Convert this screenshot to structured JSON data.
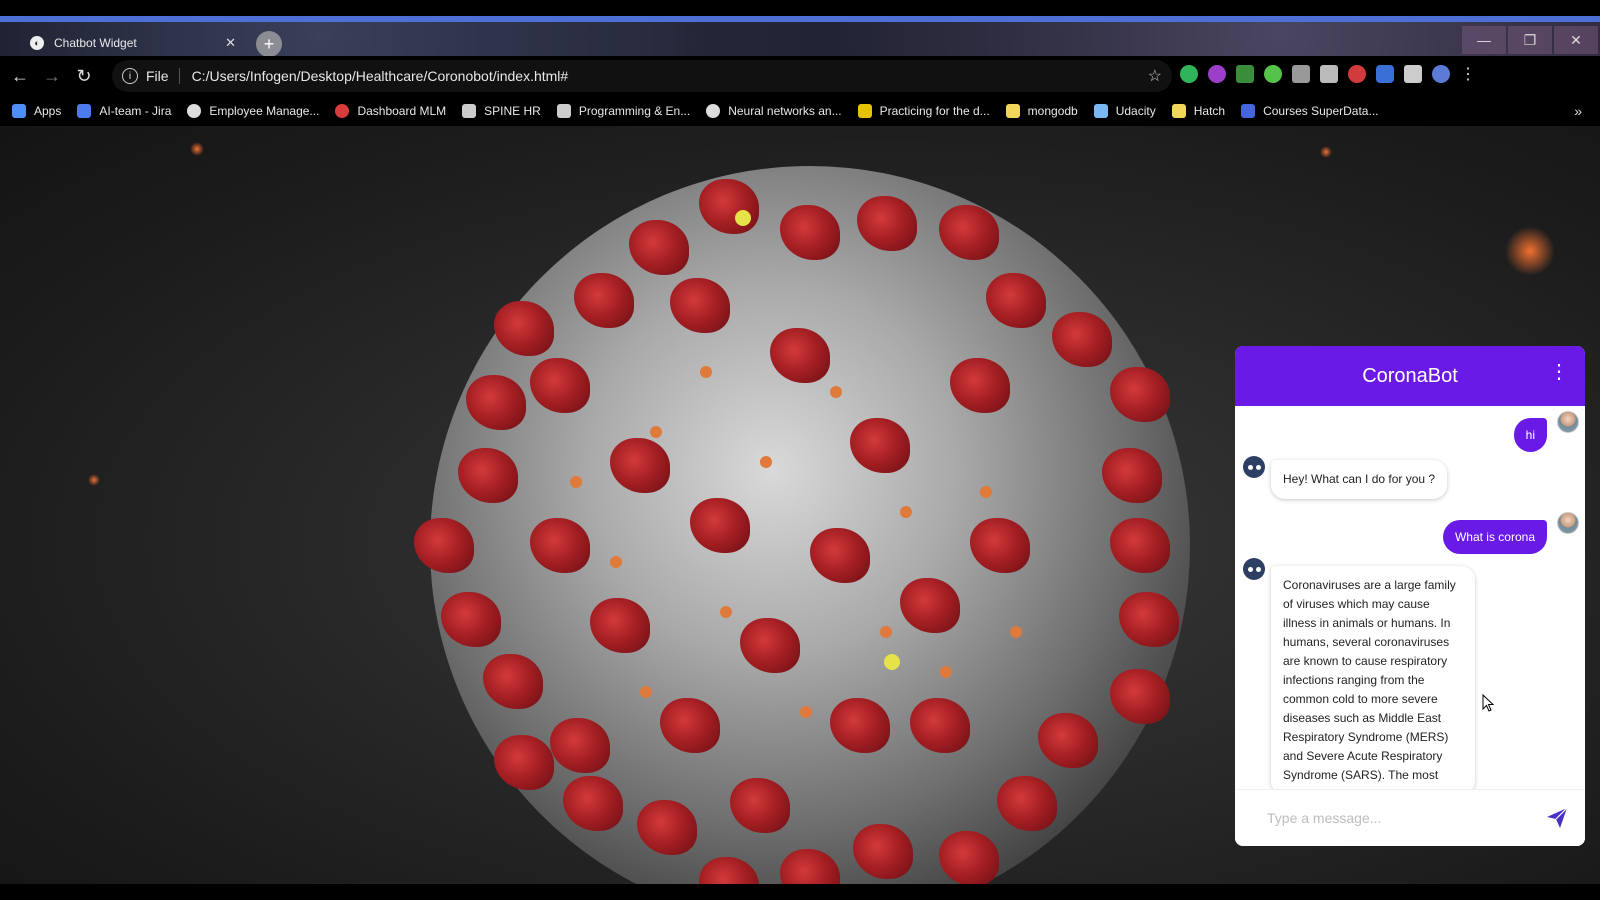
{
  "browser": {
    "tab_title": "Chatbot Widget",
    "tab_close": "✕",
    "new_tab": "+",
    "url_scheme_label": "File",
    "url": "C:/Users/Infogen/Desktop/Healthcare/Coronobot/index.html#",
    "window_controls": [
      "minimize-icon",
      "restore-icon",
      "close-icon"
    ]
  },
  "bookmarks": [
    {
      "label": "Apps",
      "icon": "apps-grid-icon",
      "color": "#4f8ef7"
    },
    {
      "label": "AI-team - Jira",
      "icon": "jira-icon",
      "color": "#4b7bec"
    },
    {
      "label": "Employee Manage...",
      "icon": "globe-icon",
      "color": "#dddddd"
    },
    {
      "label": "Dashboard MLM",
      "icon": "circle-icon",
      "color": "#d93c3c"
    },
    {
      "label": "SPINE HR",
      "icon": "image-icon",
      "color": "#cccccc"
    },
    {
      "label": "Programming & En...",
      "icon": "sf-icon",
      "color": "#cccccc"
    },
    {
      "label": "Neural networks an...",
      "icon": "globe-icon",
      "color": "#dddddd"
    },
    {
      "label": "Practicing for the d...",
      "icon": "bookmark-icon",
      "color": "#e6c200"
    },
    {
      "label": "mongodb",
      "icon": "folder-icon",
      "color": "#f2d65a"
    },
    {
      "label": "Udacity",
      "icon": "udacity-icon",
      "color": "#7ab8f5"
    },
    {
      "label": "Hatch",
      "icon": "folder-icon",
      "color": "#f2d65a"
    },
    {
      "label": "Courses SuperData...",
      "icon": "s-icon",
      "color": "#4466dd"
    }
  ],
  "bookmarks_more": "»",
  "chat": {
    "title": "CoronaBot",
    "menu_icon": "⋮",
    "messages": [
      {
        "from": "user",
        "text": "hi"
      },
      {
        "from": "bot",
        "text": "Hey! What can I do for you ?"
      },
      {
        "from": "user",
        "text": "What is corona"
      },
      {
        "from": "bot",
        "text": "Coronaviruses are a large family of viruses which may cause illness in animals or humans. In humans, several coronaviruses are known to cause respiratory infections ranging from the common cold to more severe diseases such as Middle East Respiratory Syndrome (MERS) and Severe Acute Respiratory Syndrome (SARS). The most"
      }
    ],
    "input_placeholder": "Type a message...",
    "send_icon": "send-icon",
    "accent_color": "#6a1ae6"
  }
}
